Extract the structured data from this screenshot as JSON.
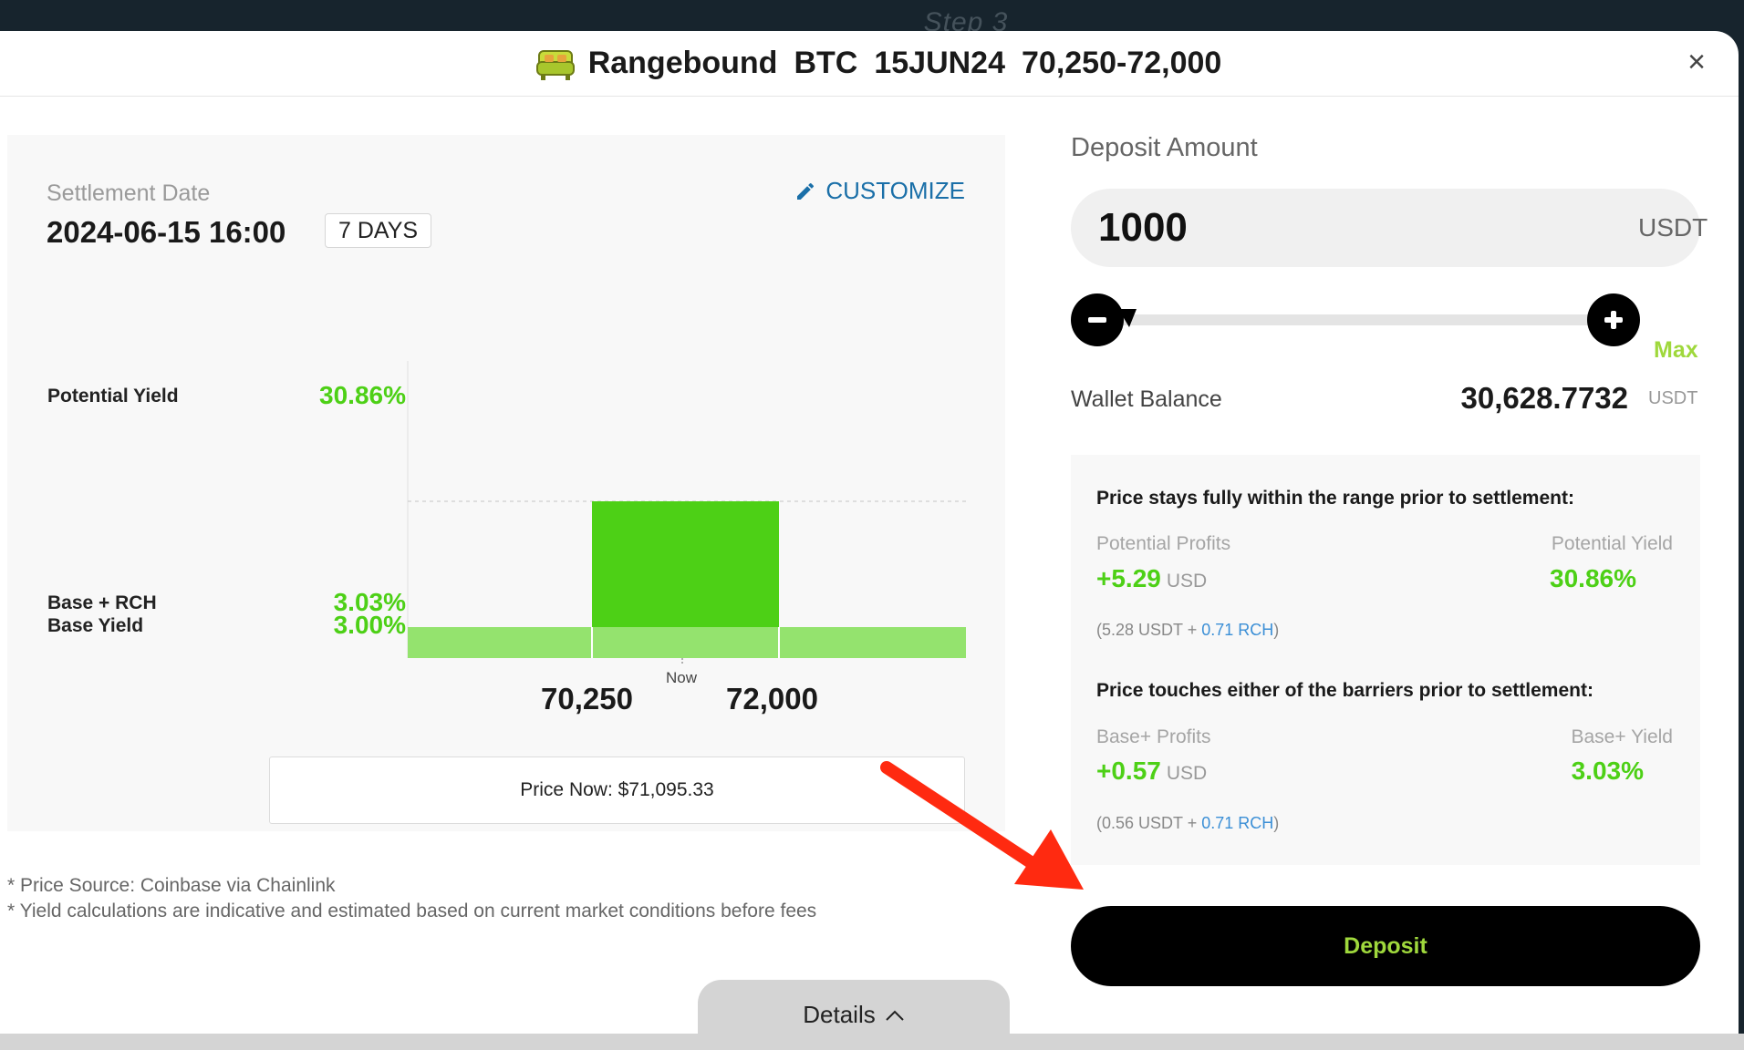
{
  "background_step": "Step 3",
  "header": {
    "product": "Rangebound",
    "asset": "BTC",
    "expiry": "15JUN24",
    "range": "70,250-72,000",
    "close_icon": "close-icon"
  },
  "settlement": {
    "label": "Settlement Date",
    "date": "2024-06-15 16:00",
    "days": "7 DAYS",
    "customize": "CUSTOMIZE"
  },
  "chart_data": {
    "type": "bar",
    "description_free": true,
    "categories": [
      "below 70,250",
      "70,250-72,000",
      "above 72,000"
    ],
    "series": [
      {
        "name": "Potential Yield",
        "values": [
          3.0,
          30.86,
          3.0
        ]
      }
    ],
    "y_labels": [
      {
        "label": "Potential Yield",
        "value": "30.86%"
      },
      {
        "label": "Base + RCH",
        "value": "3.03%"
      },
      {
        "label": "Base Yield",
        "value": "3.00%"
      }
    ],
    "x_ticks": [
      "70,250",
      "72,000"
    ],
    "now_marker": "Now",
    "colors": {
      "range_bar": "#4dd016",
      "base_bar": "#94e36e"
    }
  },
  "price_now": "Price Now: $71,095.33",
  "footnotes": [
    "* Price Source: Coinbase via Chainlink",
    "* Yield calculations are indicative and estimated based on current market conditions before fees"
  ],
  "details_tab": "Details",
  "deposit": {
    "label": "Deposit Amount",
    "amount": "1000",
    "unit": "USDT",
    "max": "Max",
    "wallet_label": "Wallet Balance",
    "wallet_value": "30,628.7732",
    "wallet_unit": "USDT"
  },
  "scenarios": [
    {
      "title": "Price stays fully within the range prior to settlement:",
      "left_label": "Potential Profits",
      "right_label": "Potential Yield",
      "profit": "+5.29",
      "profit_unit": "USD",
      "yield": "30.86%",
      "note_prefix": "(5.28 USDT + ",
      "note_rch_amount": "0.71",
      "note_rch": "RCH",
      "note_suffix": ")"
    },
    {
      "title": "Price touches either of the barriers prior to settlement:",
      "left_label": "Base+ Profits",
      "right_label": "Base+ Yield",
      "profit": "+0.57",
      "profit_unit": "USD",
      "yield": "3.03%",
      "note_prefix": "(0.56 USDT + ",
      "note_rch_amount": "0.71",
      "note_rch": "RCH",
      "note_suffix": ")"
    }
  ],
  "deposit_button": "Deposit",
  "colors": {
    "accent_green": "#4dd016",
    "lime": "#9fd83c",
    "link_blue": "#1a6fa8",
    "annotation_red": "#ff2a10"
  }
}
